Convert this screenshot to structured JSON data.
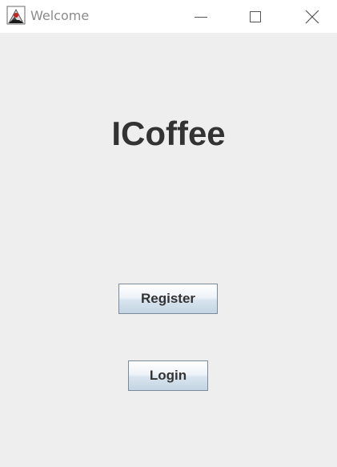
{
  "window": {
    "title": "Welcome",
    "app_icon": "java-duke-icon",
    "controls": {
      "minimize_icon": "minimize-icon",
      "maximize_icon": "maximize-icon",
      "close_icon": "close-icon"
    }
  },
  "main": {
    "app_title": "ICoffee",
    "register_label": "Register",
    "login_label": "Login"
  },
  "colors": {
    "background": "#eeeeee",
    "titlebar": "#ffffff",
    "title_text": "#8b8b8b",
    "heading_text": "#333333",
    "button_border": "#7a8a99"
  }
}
